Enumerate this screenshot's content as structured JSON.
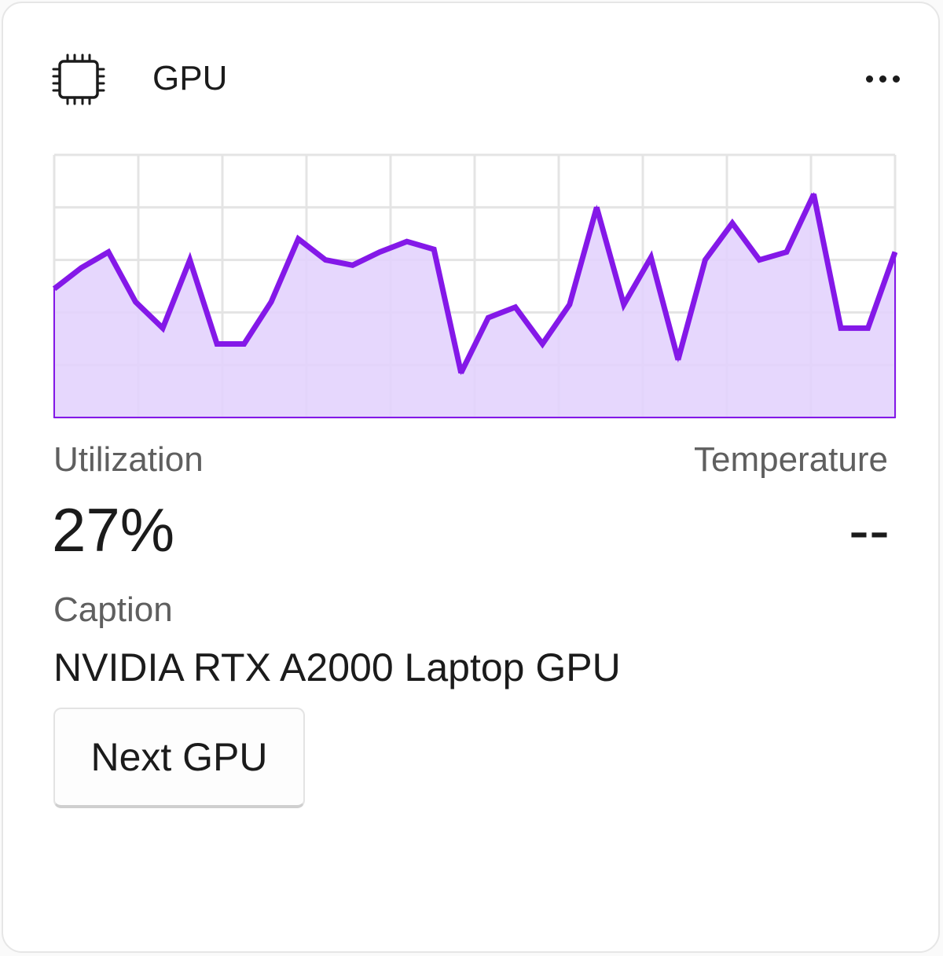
{
  "header": {
    "title": "GPU",
    "icon": "chip-icon",
    "more_icon": "more-horizontal-icon"
  },
  "chart_data": {
    "type": "area",
    "title": "",
    "xlabel": "",
    "ylabel": "",
    "ylim": [
      0,
      100
    ],
    "grid": true,
    "color": "#8418e8",
    "fill": "#e3d2fd",
    "values": [
      49,
      57,
      63,
      44,
      34,
      60,
      28,
      28,
      44,
      68,
      60,
      58,
      63,
      67,
      64,
      17,
      38,
      42,
      28,
      43,
      80,
      43,
      61,
      22,
      60,
      74,
      60,
      63,
      85,
      34,
      34,
      63
    ]
  },
  "metrics": {
    "utilization_label": "Utilization",
    "utilization_value": "27%",
    "temperature_label": "Temperature",
    "temperature_value": "--"
  },
  "caption": {
    "label": "Caption",
    "value": "NVIDIA RTX A2000 Laptop GPU"
  },
  "actions": {
    "next_label": "Next GPU"
  }
}
